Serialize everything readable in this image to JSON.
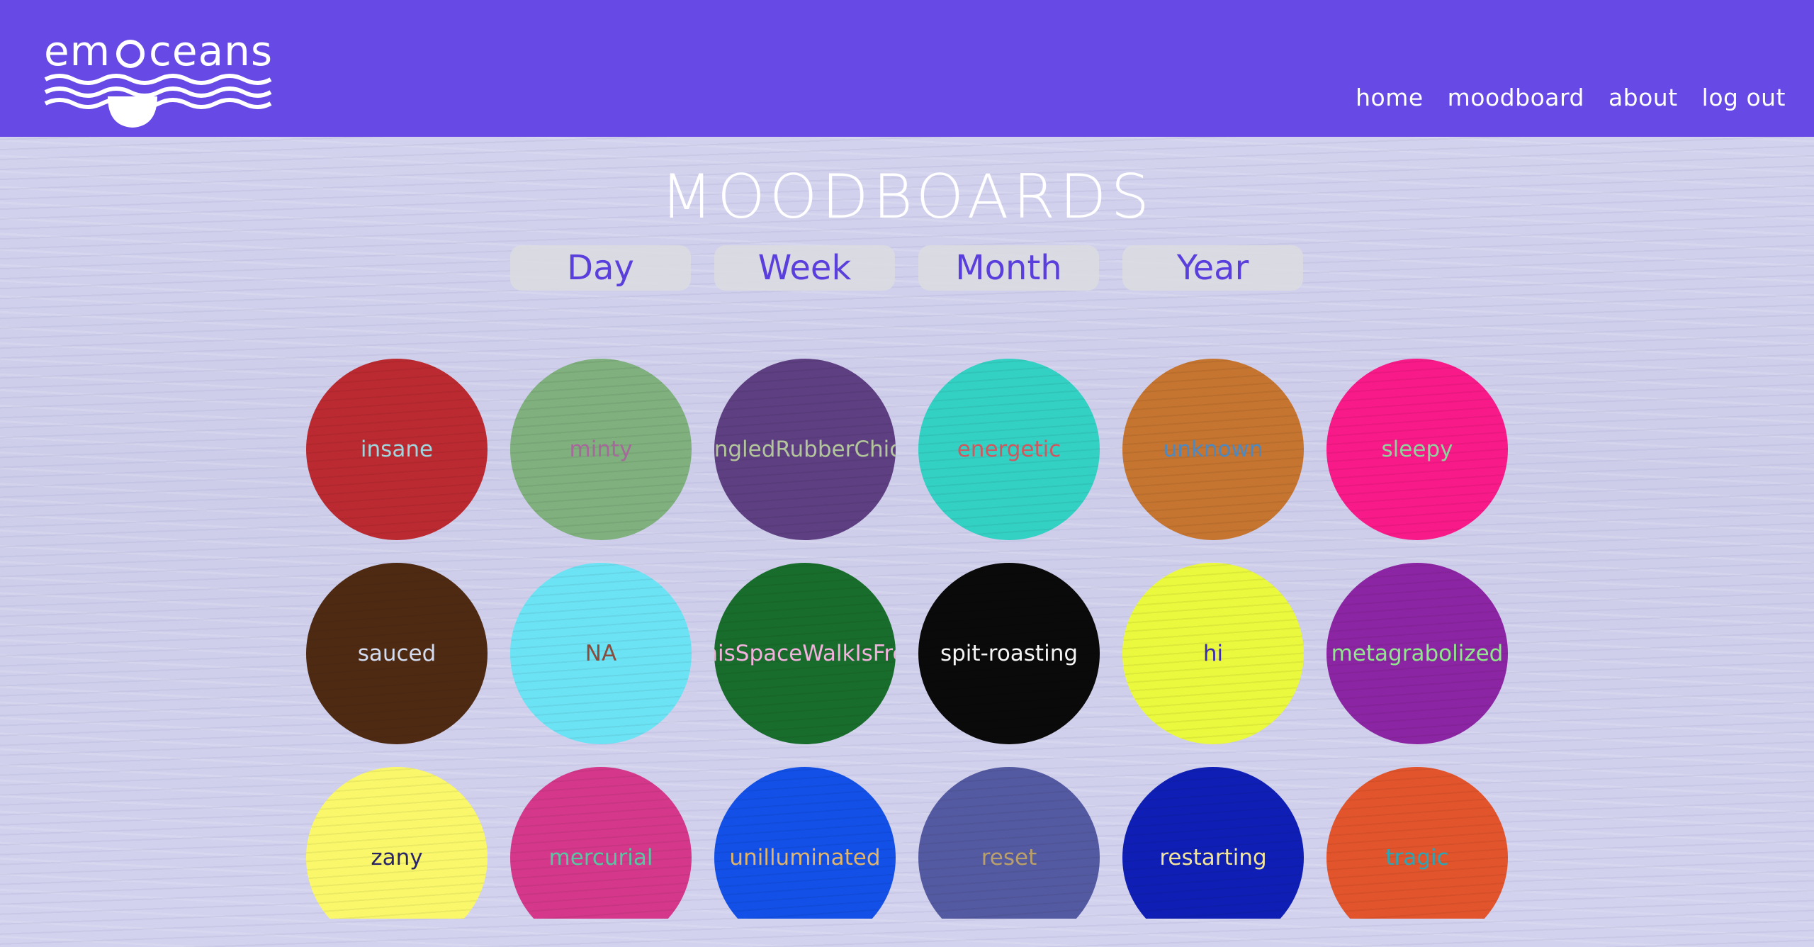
{
  "header": {
    "logo_text": "emoceans",
    "nav": [
      {
        "label": "home"
      },
      {
        "label": "moodboard"
      },
      {
        "label": "about"
      },
      {
        "label": "log out"
      }
    ]
  },
  "page_title": "MOODBOARDS",
  "periods": [
    {
      "label": "Day"
    },
    {
      "label": "Week"
    },
    {
      "label": "Month"
    },
    {
      "label": "Year"
    }
  ],
  "moods": [
    {
      "label": "insane",
      "color": "#bb2a30",
      "text_color": "#9fd6dd"
    },
    {
      "label": "minty",
      "color": "#7fb07d",
      "text_color": "#a56a9a"
    },
    {
      "label": "StrangledRubberChicken",
      "color": "#5e3f82",
      "text_color": "#b3c59a"
    },
    {
      "label": "energetic",
      "color": "#33d1c3",
      "text_color": "#d0585f"
    },
    {
      "label": "unknown",
      "color": "#c57530",
      "text_color": "#4d88c0"
    },
    {
      "label": "sleepy",
      "color": "#f81a88",
      "text_color": "#8ed39c"
    },
    {
      "label": "sauced",
      "color": "#4f2a13",
      "text_color": "#d4ddf0"
    },
    {
      "label": "NA",
      "color": "#6ce3f4",
      "text_color": "#8a4c3c"
    },
    {
      "label": "ThisSpaceWalkIsFree",
      "color": "#186d2c",
      "text_color": "#f3b2dd"
    },
    {
      "label": "spit-roasting",
      "color": "#0a0a0a",
      "text_color": "#f5f5f5"
    },
    {
      "label": "hi",
      "color": "#eaf83e",
      "text_color": "#3a2ab5"
    },
    {
      "label": "metagrabolized",
      "color": "#8c25a3",
      "text_color": "#8fe88a"
    },
    {
      "label": "zany",
      "color": "#faf86a",
      "text_color": "#2a2468"
    },
    {
      "label": "mercurial",
      "color": "#d5388a",
      "text_color": "#56c7a3"
    },
    {
      "label": "unilluminated",
      "color": "#1250e8",
      "text_color": "#e0b46a"
    },
    {
      "label": "reset",
      "color": "#545aa1",
      "text_color": "#b99f6b"
    },
    {
      "label": "restarting",
      "color": "#0f1fb5",
      "text_color": "#f2e49a"
    },
    {
      "label": "tragic",
      "color": "#e2542c",
      "text_color": "#2aa7b7"
    }
  ]
}
